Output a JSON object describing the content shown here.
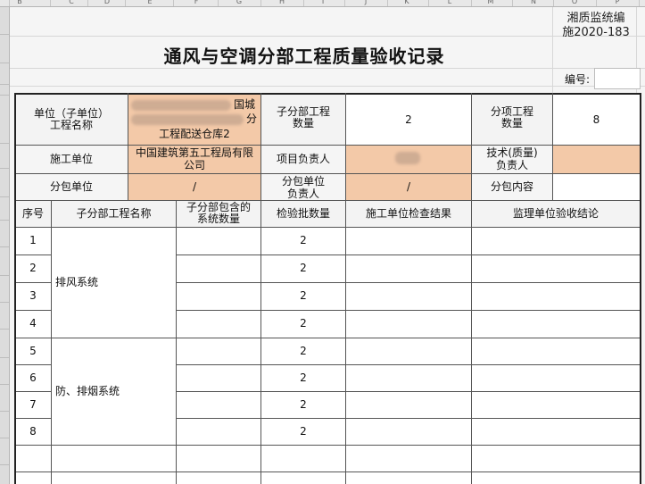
{
  "column_headers": [
    "B",
    "C",
    "D",
    "E",
    "F",
    "G",
    "H",
    "I",
    "J",
    "K",
    "L",
    "M",
    "N",
    "O",
    "P"
  ],
  "document": {
    "code_line1": "湘质监统编",
    "code_line2": "施2020-183",
    "title": "通风与空调分部工程质量验收记录",
    "number_label": "编号:",
    "number_value": ""
  },
  "form": {
    "unit_label_1": "单位（子单位）",
    "unit_label_2": "工程名称",
    "unit_value_visible_1": "国城",
    "unit_value_visible_2": "分",
    "unit_value_visible_3": "工程配送仓库2",
    "sub_count_label_1": "子分部工程",
    "sub_count_label_2": "数量",
    "sub_count_value": "2",
    "item_count_label_1": "分项工程",
    "item_count_label_2": "数量",
    "item_count_value": "8",
    "contractor_label": "施工单位",
    "contractor_value_1": "中国建筑第五工程局有限",
    "contractor_value_2": "公司",
    "pm_label": "项目负责人",
    "pm_value": "",
    "tech_label_1": "技术(质量)",
    "tech_label_2": "负责人",
    "tech_value": "",
    "sub_unit_label": "分包单位",
    "sub_unit_value": "/",
    "sub_lead_label_1": "分包单位",
    "sub_lead_label_2": "负责人",
    "sub_lead_value": "/",
    "sub_content_label": "分包内容",
    "sub_content_value": ""
  },
  "table": {
    "headers": {
      "seq": "序号",
      "name": "子分部工程名称",
      "sys_count_1": "子分部包含的",
      "sys_count_2": "系统数量",
      "batch_count": "检验批数量",
      "check_result": "施工单位检查结果",
      "conclusion": "监理单位验收结论"
    },
    "rows": [
      {
        "seq": "1",
        "batch": "2"
      },
      {
        "seq": "2",
        "batch": "2"
      },
      {
        "seq": "3",
        "batch": "2"
      },
      {
        "seq": "4",
        "batch": "2"
      },
      {
        "seq": "5",
        "batch": "2"
      },
      {
        "seq": "6",
        "batch": "2"
      },
      {
        "seq": "7",
        "batch": "2"
      },
      {
        "seq": "8",
        "batch": "2"
      },
      {
        "seq": "",
        "batch": ""
      },
      {
        "seq": "",
        "batch": ""
      }
    ],
    "groups": [
      {
        "name": "排风系统"
      },
      {
        "name": "防、排烟系统"
      }
    ]
  }
}
